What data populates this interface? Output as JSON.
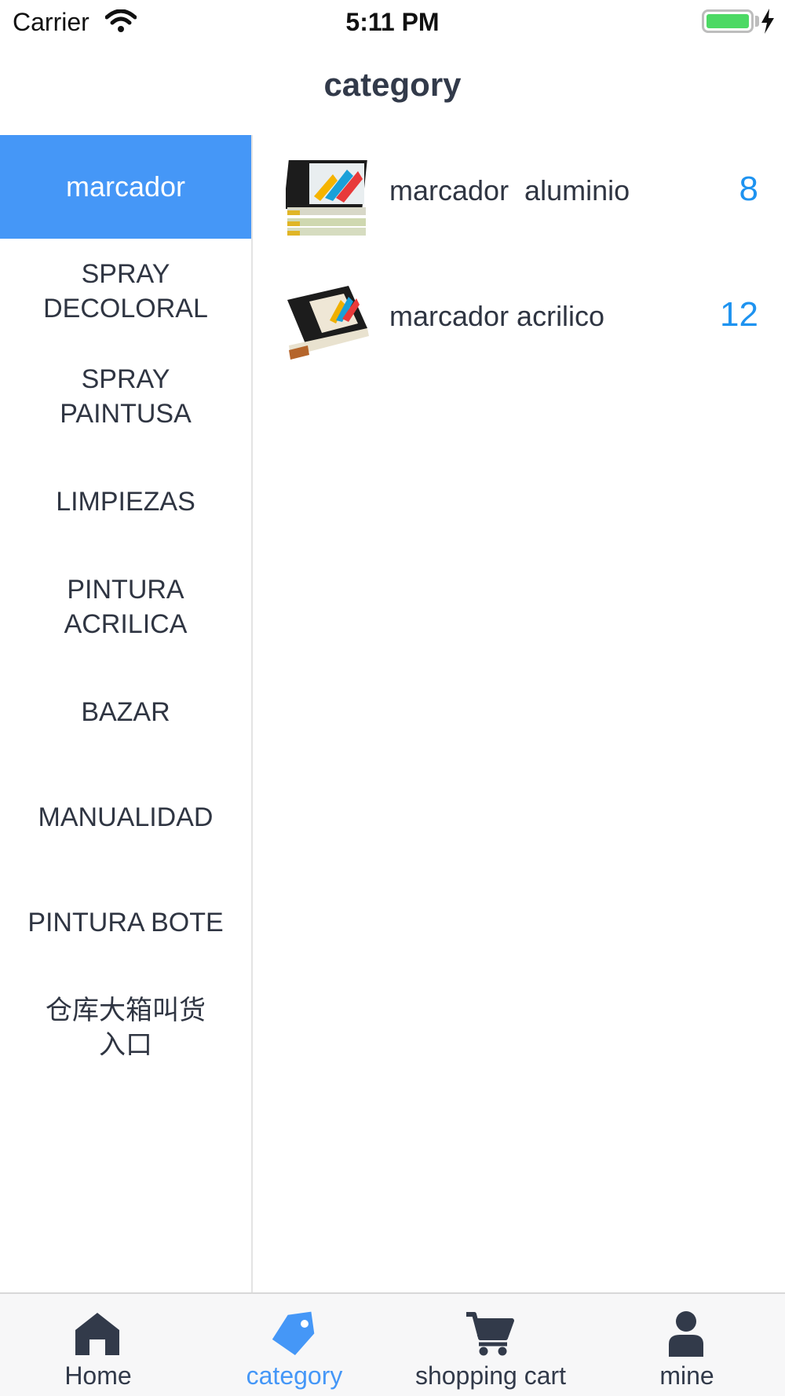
{
  "status_bar": {
    "carrier": "Carrier",
    "time": "5:11 PM",
    "battery_color": "#4cd964"
  },
  "nav": {
    "title": "category"
  },
  "sidebar": {
    "accent": "#4597f7",
    "items": [
      {
        "label": "marcador",
        "active": true
      },
      {
        "label": "SPRAY DECOLORAL"
      },
      {
        "label": "SPRAY PAINTUSA"
      },
      {
        "label": "LIMPIEZAS"
      },
      {
        "label": "PINTURA ACRILICA"
      },
      {
        "label": "BAZAR"
      },
      {
        "label": "MANUALIDAD"
      },
      {
        "label": "PINTURA BOTE"
      },
      {
        "label": "仓库大箱叫货入口"
      }
    ]
  },
  "products": [
    {
      "name": "marcador  aluminio",
      "count": "8",
      "icon": "marker-box-image"
    },
    {
      "name": "marcador acrilico",
      "count": "12",
      "icon": "marker-box-image"
    }
  ],
  "tabbar": {
    "items": [
      {
        "label": "Home",
        "icon": "home-icon"
      },
      {
        "label": "category",
        "icon": "tag-icon",
        "active": true
      },
      {
        "label": "shopping cart",
        "icon": "cart-icon"
      },
      {
        "label": "mine",
        "icon": "person-icon"
      }
    ],
    "active_color": "#4597f7",
    "inactive_color": "#323a4a"
  }
}
